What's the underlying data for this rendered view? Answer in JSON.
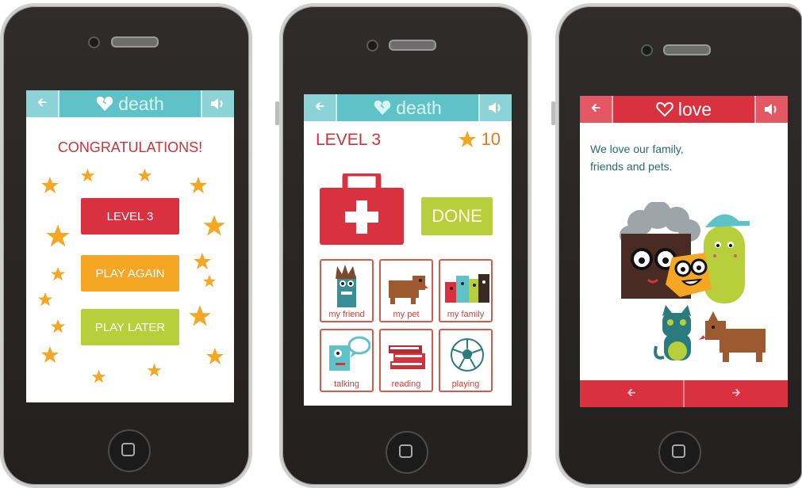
{
  "screen1": {
    "topbar": {
      "back_icon": "arrow-left-icon",
      "topic_icon": "broken-heart-icon",
      "title": "death",
      "sound_icon": "speaker-icon"
    },
    "congrats": "CONGRATULATIONS!",
    "buttons": {
      "level": "LEVEL 3",
      "play_again": "PLAY AGAIN",
      "play_later": "PLAY LATER"
    },
    "colors": {
      "bar": "#5fc2c6",
      "level": "#d9313f",
      "play_again": "#f5a623",
      "play_later": "#b8cf3c",
      "star": "#f5a623"
    }
  },
  "screen2": {
    "topbar": {
      "back_icon": "arrow-left-icon",
      "topic_icon": "broken-heart-icon",
      "title": "death",
      "sound_icon": "speaker-icon"
    },
    "level": "LEVEL 3",
    "score": "10",
    "done": "DONE",
    "tiles": [
      {
        "label": "my friend",
        "icon": "friend-monster-icon"
      },
      {
        "label": "my pet",
        "icon": "dog-icon"
      },
      {
        "label": "my family",
        "icon": "family-icon"
      },
      {
        "label": "talking",
        "icon": "speech-bubble-icon"
      },
      {
        "label": "reading",
        "icon": "books-icon"
      },
      {
        "label": "playing",
        "icon": "soccer-ball-icon"
      }
    ]
  },
  "screen3": {
    "topbar": {
      "back_icon": "arrow-left-icon",
      "topic_icon": "heart-icon",
      "title": "love",
      "sound_icon": "speaker-icon"
    },
    "text_line1": "We love our family,",
    "text_line2": "friends and pets.",
    "nav": {
      "prev_icon": "arrow-left-icon",
      "next_icon": "arrow-right-icon"
    },
    "colors": {
      "bar": "#d9313f"
    }
  }
}
